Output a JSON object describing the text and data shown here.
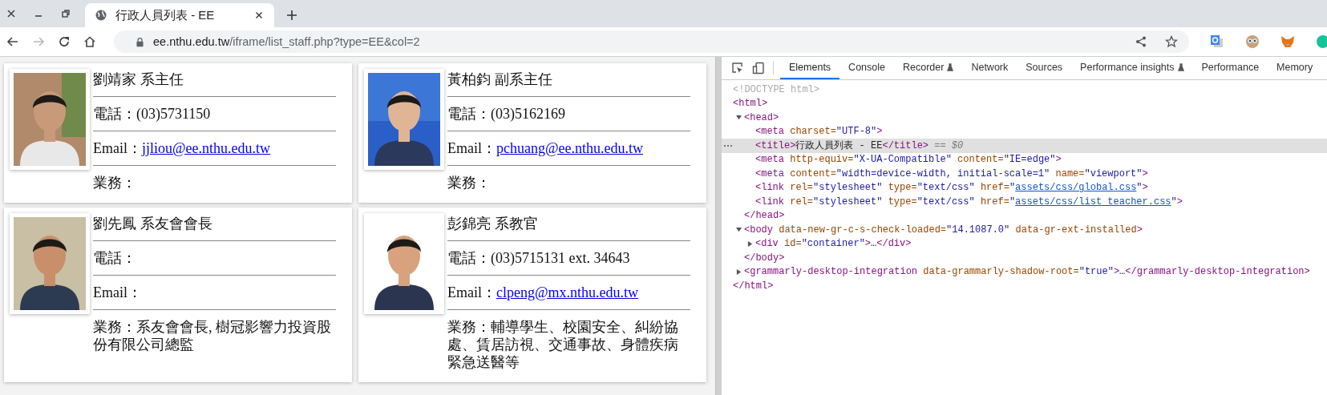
{
  "browser": {
    "tab_title": "行政人員列表 - EE",
    "url_host": "ee.nthu.edu.tw",
    "url_path": "/iframe/list_staff.php?type=EE&col=2",
    "forward_disabled": true
  },
  "cards": [
    {
      "name": "劉靖家 系主任",
      "phone": "電話：(03)5731150",
      "email_label": "Email：",
      "email": "jjliou@ee.nthu.edu.tw",
      "duties": "業務："
    },
    {
      "name": "黃柏鈞 副系主任",
      "phone": "電話：(03)5162169",
      "email_label": "Email：",
      "email": "pchuang@ee.nthu.edu.tw",
      "duties": "業務："
    },
    {
      "name": "劉先鳳 系友會會長",
      "phone": "電話：",
      "email_label": "Email：",
      "duties": "業務：系友會會長, 樹冠影響力投資股份有限公司總監"
    },
    {
      "name": "彭錦亮 系教官",
      "phone": "電話：(03)5715131 ext. 34643",
      "email_label": "Email：",
      "email": "clpeng@mx.nthu.edu.tw",
      "duties": "業務：輔導學生、校園安全、糾紛協處、賃居訪視、交通事故、身體疾病緊急送醫等"
    }
  ],
  "devtools": {
    "tabs": [
      {
        "label": "Elements",
        "selected": true,
        "experimental": false
      },
      {
        "label": "Console",
        "selected": false,
        "experimental": false
      },
      {
        "label": "Recorder",
        "selected": false,
        "experimental": true
      },
      {
        "label": "Network",
        "selected": false,
        "experimental": false
      },
      {
        "label": "Sources",
        "selected": false,
        "experimental": false
      },
      {
        "label": "Performance insights",
        "selected": false,
        "experimental": true
      },
      {
        "label": "Performance",
        "selected": false,
        "experimental": false
      },
      {
        "label": "Memory",
        "selected": false,
        "experimental": false
      }
    ],
    "dom": [
      {
        "selected": false,
        "parts": [
          {
            "kind": "doctype",
            "text": "<!DOCTYPE html>"
          }
        ]
      },
      {
        "selected": false,
        "parts": [
          {
            "kind": "tag",
            "text": "<html>"
          }
        ],
        "close": "</html>",
        "children": [
          {
            "selected": false,
            "expanded": true,
            "parts": [
              {
                "kind": "tag",
                "text": "<head>"
              }
            ],
            "close": "</head>",
            "children": [
              {
                "selected": false,
                "parts": [
                  {
                    "kind": "tag",
                    "text": "<meta"
                  },
                  {
                    "kind": "attr",
                    "text": " charset="
                  },
                  {
                    "kind": "value",
                    "text": "\"UTF-8\""
                  },
                  {
                    "kind": "tag",
                    "text": ">"
                  }
                ]
              },
              {
                "selected": true,
                "parts": [
                  {
                    "kind": "tag",
                    "text": "<title>"
                  },
                  {
                    "kind": "text",
                    "text": "行政人員列表 - EE"
                  },
                  {
                    "kind": "tag",
                    "text": "</title>"
                  },
                  {
                    "kind": "note",
                    "text": " == $0"
                  }
                ]
              },
              {
                "selected": false,
                "parts": [
                  {
                    "kind": "tag",
                    "text": "<meta"
                  },
                  {
                    "kind": "attr",
                    "text": " http-equiv="
                  },
                  {
                    "kind": "value",
                    "text": "\"X-UA-Compatible\""
                  },
                  {
                    "kind": "attr",
                    "text": " content="
                  },
                  {
                    "kind": "value",
                    "text": "\"IE=edge\""
                  },
                  {
                    "kind": "tag",
                    "text": ">"
                  }
                ]
              },
              {
                "selected": false,
                "parts": [
                  {
                    "kind": "tag",
                    "text": "<meta"
                  },
                  {
                    "kind": "attr",
                    "text": " content="
                  },
                  {
                    "kind": "value",
                    "text": "\"width=device-width, initial-scale=1\""
                  },
                  {
                    "kind": "attr",
                    "text": " name="
                  },
                  {
                    "kind": "value",
                    "text": "\"viewport\""
                  },
                  {
                    "kind": "tag",
                    "text": ">"
                  }
                ]
              },
              {
                "selected": false,
                "parts": [
                  {
                    "kind": "tag",
                    "text": "<link"
                  },
                  {
                    "kind": "attr",
                    "text": " rel="
                  },
                  {
                    "kind": "value",
                    "text": "\"stylesheet\""
                  },
                  {
                    "kind": "attr",
                    "text": " type="
                  },
                  {
                    "kind": "value",
                    "text": "\"text/css\""
                  },
                  {
                    "kind": "attr",
                    "text": " href="
                  },
                  {
                    "kind": "value",
                    "text": "\""
                  },
                  {
                    "kind": "link",
                    "text": "assets/css/global.css"
                  },
                  {
                    "kind": "value",
                    "text": "\""
                  },
                  {
                    "kind": "tag",
                    "text": ">"
                  }
                ]
              },
              {
                "selected": false,
                "parts": [
                  {
                    "kind": "tag",
                    "text": "<link"
                  },
                  {
                    "kind": "attr",
                    "text": " rel="
                  },
                  {
                    "kind": "value",
                    "text": "\"stylesheet\""
                  },
                  {
                    "kind": "attr",
                    "text": " type="
                  },
                  {
                    "kind": "value",
                    "text": "\"text/css\""
                  },
                  {
                    "kind": "attr",
                    "text": " href="
                  },
                  {
                    "kind": "value",
                    "text": "\""
                  },
                  {
                    "kind": "link",
                    "text": "assets/css/list_teacher.css"
                  },
                  {
                    "kind": "value",
                    "text": "\""
                  },
                  {
                    "kind": "tag",
                    "text": ">"
                  }
                ]
              }
            ]
          },
          {
            "selected": false,
            "expanded": true,
            "parts": [
              {
                "kind": "tag",
                "text": "<body"
              },
              {
                "kind": "attr",
                "text": " data-new-gr-c-s-check-loaded="
              },
              {
                "kind": "value",
                "text": "\"14.1087.0\""
              },
              {
                "kind": "attr",
                "text": " data-gr-ext-installed"
              },
              {
                "kind": "tag",
                "text": ">"
              }
            ],
            "close": "</body>",
            "children": [
              {
                "selected": false,
                "expanded": false,
                "parts": [
                  {
                    "kind": "tag",
                    "text": "<div"
                  },
                  {
                    "kind": "attr",
                    "text": " id="
                  },
                  {
                    "kind": "value",
                    "text": "\"container\""
                  },
                  {
                    "kind": "tag",
                    "text": ">"
                  },
                  {
                    "kind": "text",
                    "text": "…"
                  },
                  {
                    "kind": "tag",
                    "text": "</div>"
                  }
                ]
              }
            ]
          },
          {
            "selected": false,
            "expanded": false,
            "parts": [
              {
                "kind": "tag",
                "text": "<grammarly-desktop-integration"
              },
              {
                "kind": "attr",
                "text": " data-grammarly-shadow-root="
              },
              {
                "kind": "value",
                "text": "\"true\""
              },
              {
                "kind": "tag",
                "text": ">"
              },
              {
                "kind": "text",
                "text": "…"
              },
              {
                "kind": "tag",
                "text": "</grammarly-desktop-integration>"
              }
            ]
          }
        ]
      }
    ]
  }
}
